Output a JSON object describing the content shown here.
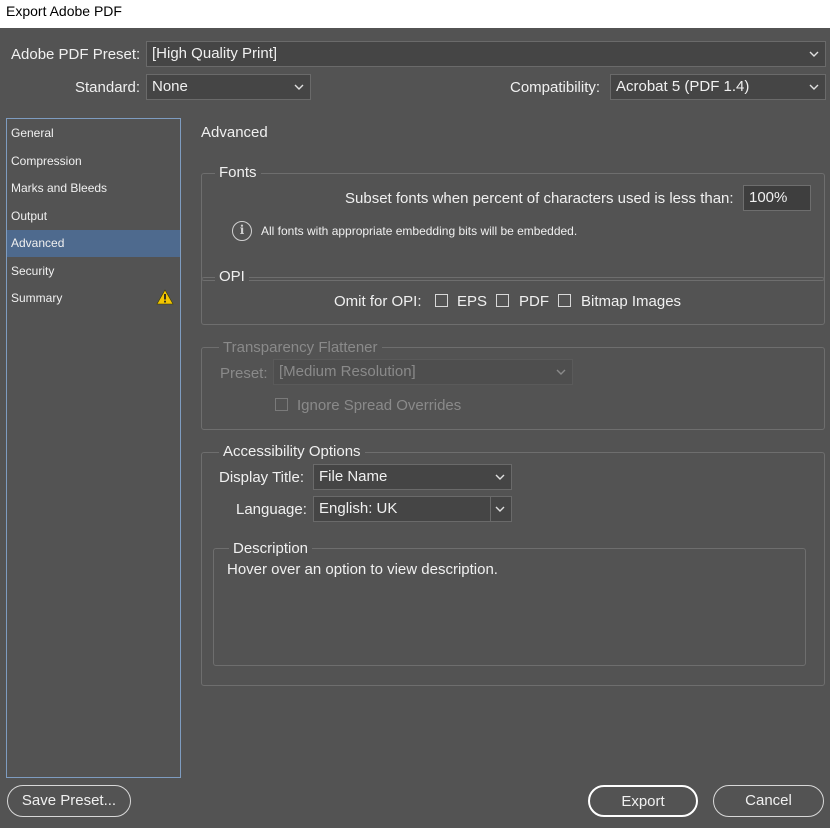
{
  "window": {
    "title": "Export Adobe PDF"
  },
  "header": {
    "preset_label": "Adobe PDF Preset:",
    "preset_value": "[High Quality Print]",
    "standard_label": "Standard:",
    "standard_value": "None",
    "compatibility_label": "Compatibility:",
    "compatibility_value": "Acrobat 5 (PDF 1.4)"
  },
  "sidebar": {
    "items": [
      {
        "label": "General"
      },
      {
        "label": "Compression"
      },
      {
        "label": "Marks and Bleeds"
      },
      {
        "label": "Output"
      },
      {
        "label": "Advanced",
        "selected": true
      },
      {
        "label": "Security"
      },
      {
        "label": "Summary",
        "icon": "warning-icon"
      }
    ]
  },
  "panel": {
    "title": "Advanced",
    "fonts": {
      "title": "Fonts",
      "subset_label": "Subset fonts when percent of characters used is less than:",
      "subset_value": "100%",
      "info_text": "All fonts with appropriate embedding bits will be embedded."
    },
    "opi": {
      "title": "OPI",
      "omit_label": "Omit for OPI:",
      "options": [
        {
          "label": "EPS",
          "checked": false
        },
        {
          "label": "PDF",
          "checked": false
        },
        {
          "label": "Bitmap Images",
          "checked": false
        }
      ]
    },
    "transparency": {
      "title": "Transparency Flattener",
      "preset_label": "Preset:",
      "preset_value": "[Medium Resolution]",
      "ignore_label": "Ignore Spread Overrides",
      "ignore_checked": false,
      "disabled": true
    },
    "accessibility": {
      "title": "Accessibility Options",
      "display_title_label": "Display Title:",
      "display_title_value": "File Name",
      "language_label": "Language:",
      "language_value": "English: UK"
    },
    "description": {
      "title": "Description",
      "text": "Hover over an option to view description."
    }
  },
  "footer": {
    "save_preset": "Save Preset...",
    "export": "Export",
    "cancel": "Cancel"
  },
  "colors": {
    "background": "#535353",
    "selected_item": "#4e6a8e",
    "sidebar_border": "#7e9cc0",
    "warning": "#f2c500"
  }
}
